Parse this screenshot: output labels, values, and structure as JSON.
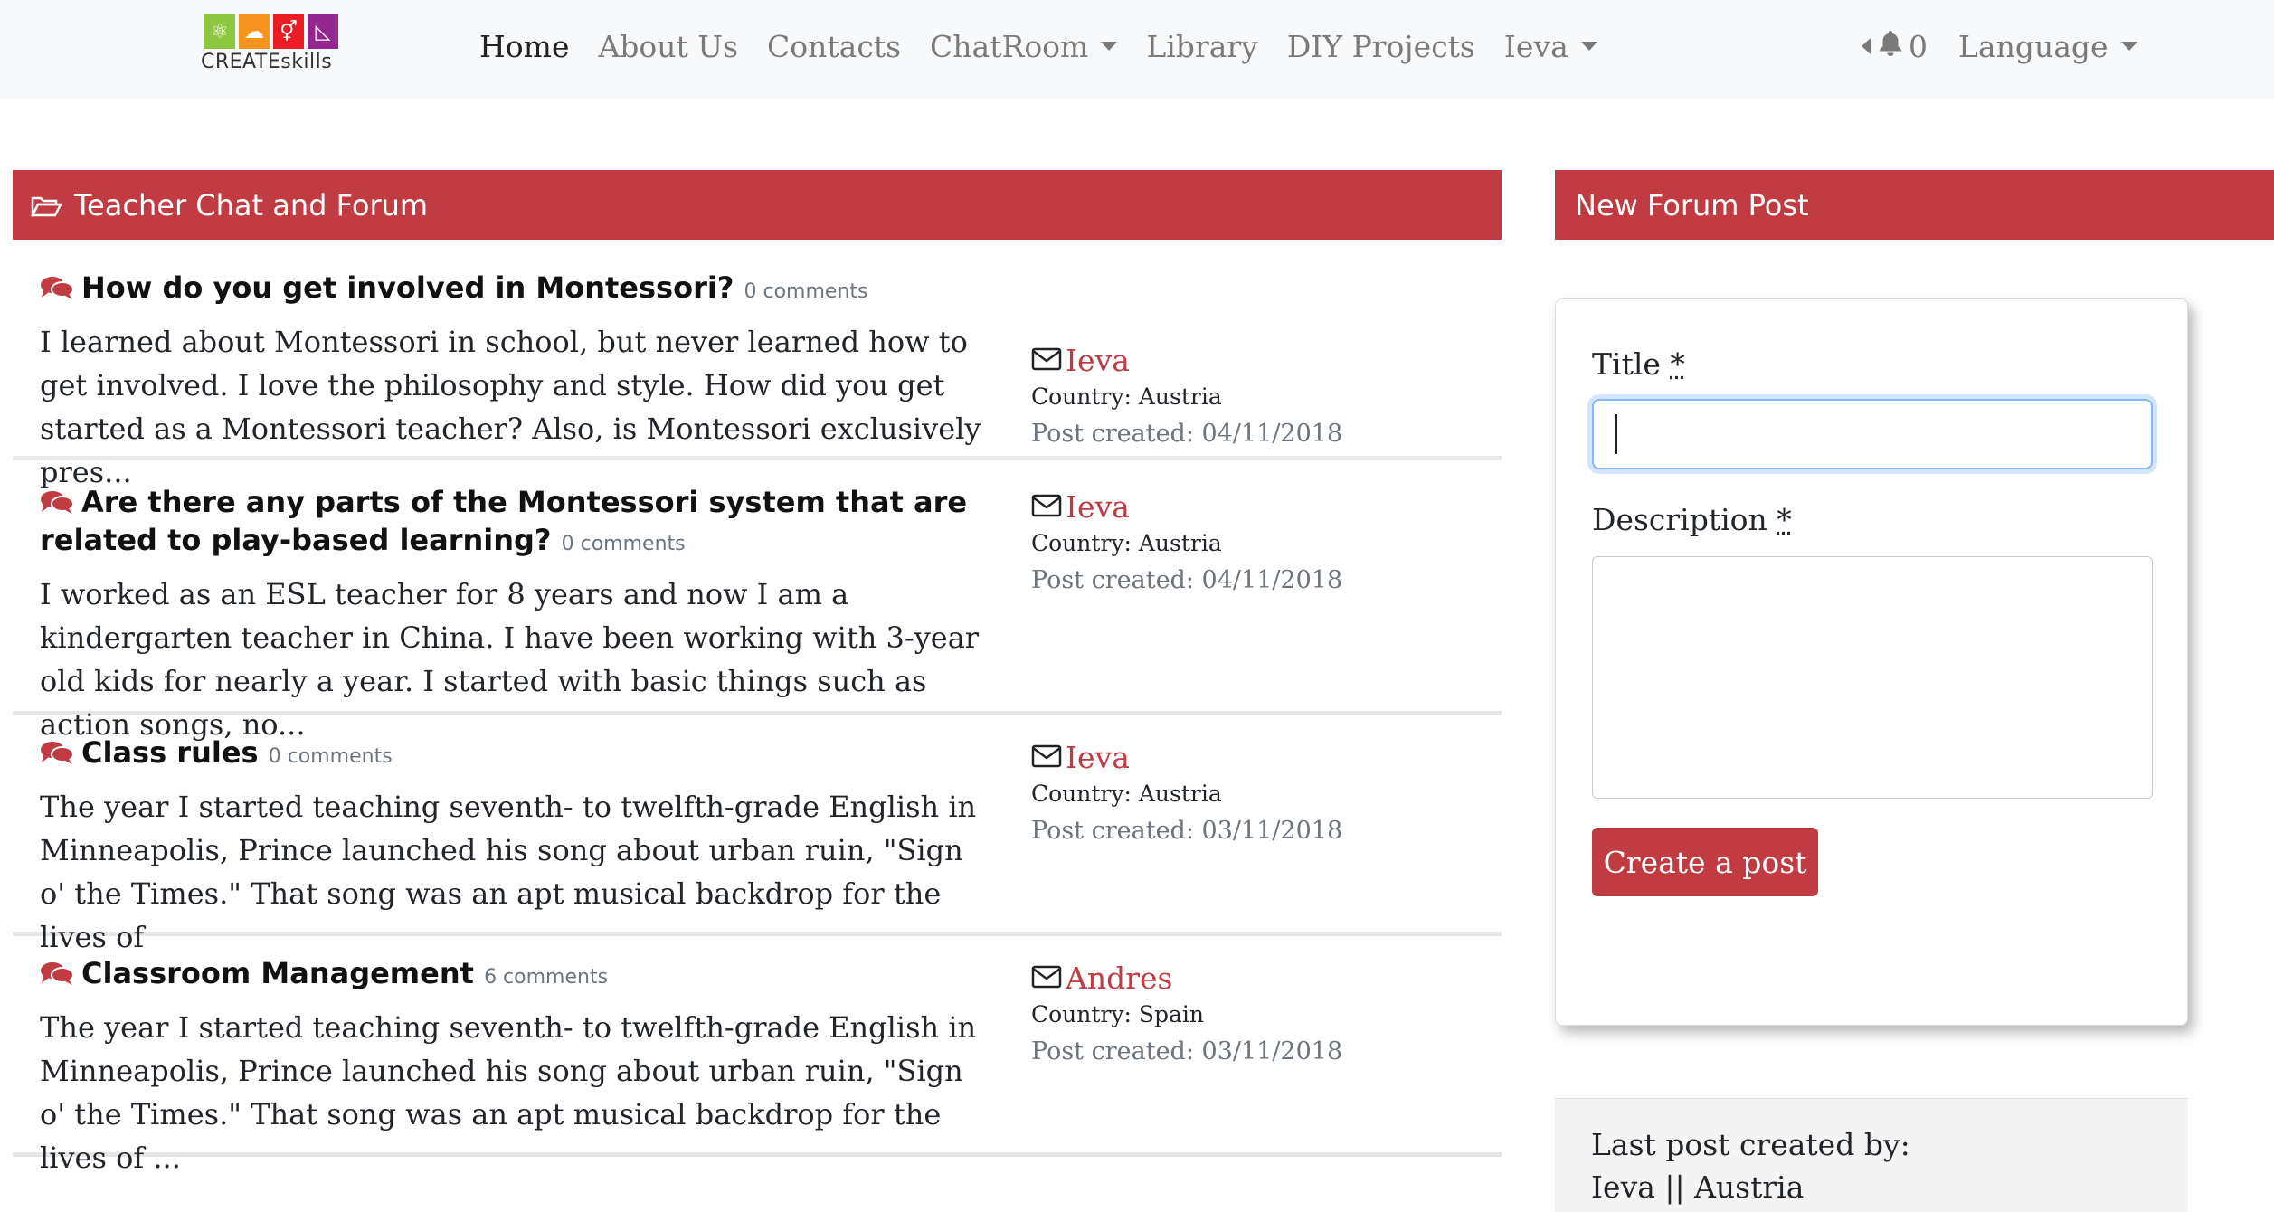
{
  "brand": {
    "logo_text": "CREATEskills",
    "tile_colors": [
      "#8dc63f",
      "#f7941d",
      "#ec1c24",
      "#92278f"
    ]
  },
  "nav": {
    "items": [
      {
        "label": "Home",
        "active": true,
        "dropdown": false
      },
      {
        "label": "About Us",
        "active": false,
        "dropdown": false
      },
      {
        "label": "Contacts",
        "active": false,
        "dropdown": false
      },
      {
        "label": "ChatRoom",
        "active": false,
        "dropdown": true
      },
      {
        "label": "Library",
        "active": false,
        "dropdown": false
      },
      {
        "label": "DIY Projects",
        "active": false,
        "dropdown": false
      },
      {
        "label": "Ieva",
        "active": false,
        "dropdown": true
      }
    ],
    "notification_count": "0",
    "language_label": "Language"
  },
  "forum": {
    "header": "Teacher Chat and Forum",
    "posts": [
      {
        "title": "How do you get involved in Montessori?",
        "comments": "0 comments",
        "desc": "I learned about Montessori in school, but never learned how to get involved. I love the philosophy and style. How did you get started as a Montessori teacher? Also, is Montessori exclusively pres...",
        "author": "Ieva",
        "country": "Country: Austria",
        "created": "Post created: 04/11/2018"
      },
      {
        "title": "Are there any parts of the Montessori system that are related to play-based learning?",
        "comments": "0 comments",
        "desc": "I worked as an ESL teacher for 8 years and now I am a kindergarten teacher in China. I have been working with 3-year old kids for nearly a year. I started with basic things such as action songs, no...",
        "author": "Ieva",
        "country": "Country: Austria",
        "created": "Post created: 04/11/2018"
      },
      {
        "title": "Class rules",
        "comments": "0 comments",
        "desc": "The year I started teaching seventh- to twelfth-grade English in Minneapolis, Prince launched his song about urban ruin, \"Sign o' the Times.\" That song was an apt musical backdrop for the lives of",
        "author": "Ieva",
        "country": "Country: Austria",
        "created": "Post created: 03/11/2018"
      },
      {
        "title": "Classroom Management",
        "comments": "6 comments",
        "desc": "The year I started teaching seventh- to twelfth-grade English in Minneapolis, Prince launched his song about urban ruin, \"Sign o' the Times.\" That song was an apt musical backdrop for the lives of ...",
        "author": "Andres",
        "country": "Country: Spain",
        "created": "Post created: 03/11/2018"
      }
    ]
  },
  "new_post": {
    "header": "New Forum Post",
    "title_label": "Title",
    "title_value": "",
    "description_label": "Description",
    "description_value": "",
    "required_mark": "*",
    "submit_label": "Create a post"
  },
  "last_post": {
    "label": "Last post created by:",
    "value": "Ieva || Austria"
  },
  "colors": {
    "accent": "#c13b43",
    "navbar_bg": "#f8f9fa",
    "muted": "#6c757d",
    "focus": "#86b7fe"
  }
}
